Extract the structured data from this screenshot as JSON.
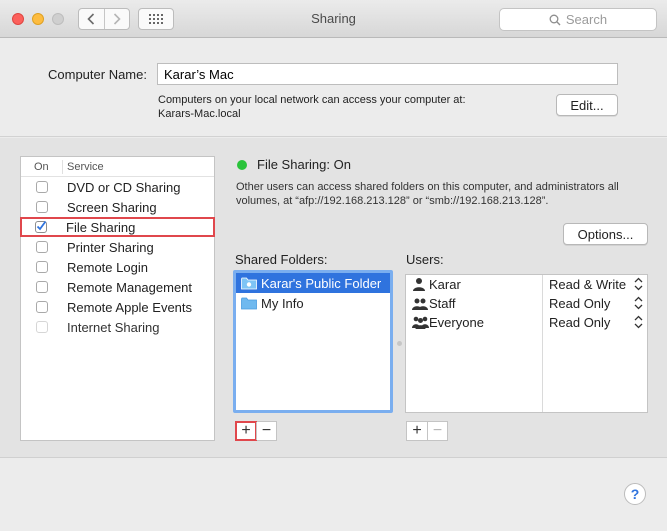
{
  "window": {
    "title": "Sharing"
  },
  "search": {
    "placeholder": "Search"
  },
  "computer": {
    "label": "Computer Name:",
    "name": "Karar’s Mac",
    "description_line1": "Computers on your local network can access your computer at:",
    "description_line2": "Karars-Mac.local",
    "edit_label": "Edit..."
  },
  "services": {
    "header_on": "On",
    "header_service": "Service",
    "items": [
      {
        "label": "DVD or CD Sharing",
        "checked": false
      },
      {
        "label": "Screen Sharing",
        "checked": false
      },
      {
        "label": "File Sharing",
        "checked": true
      },
      {
        "label": "Printer Sharing",
        "checked": false
      },
      {
        "label": "Remote Login",
        "checked": false
      },
      {
        "label": "Remote Management",
        "checked": false
      },
      {
        "label": "Remote Apple Events",
        "checked": false
      },
      {
        "label": "Internet Sharing",
        "checked": false
      }
    ]
  },
  "status": {
    "text": "File Sharing: On",
    "color": "#2ac33b",
    "description": "Other users can access shared folders on this computer, and administrators all volumes, at “afp://192.168.213.128” or “smb://192.168.213.128”."
  },
  "options_label": "Options...",
  "shared_folders": {
    "label": "Shared Folders:",
    "items": [
      "Karar's Public Folder",
      "My Info"
    ]
  },
  "users": {
    "label": "Users:",
    "items": [
      {
        "name": "Karar",
        "permission": "Read & Write",
        "icon": "single-user-icon"
      },
      {
        "name": "Staff",
        "permission": "Read Only",
        "icon": "group-icon"
      },
      {
        "name": "Everyone",
        "permission": "Read Only",
        "icon": "everyone-icon"
      }
    ]
  },
  "buttons": {
    "plus": "+",
    "minus": "−"
  },
  "help_label": "?"
}
